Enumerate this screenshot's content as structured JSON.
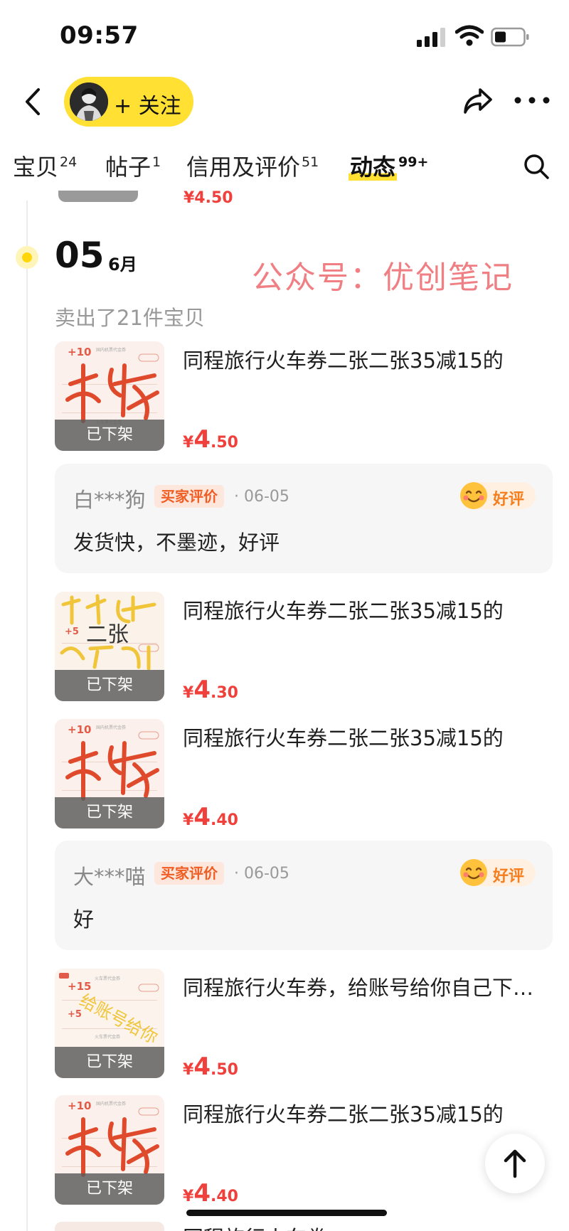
{
  "status_bar": {
    "time": "09:57"
  },
  "header": {
    "follow_label": "+ 关注"
  },
  "tabs": [
    {
      "label": "宝贝",
      "count": "24",
      "active": false
    },
    {
      "label": "帖子",
      "count": "1",
      "active": false
    },
    {
      "label": "信用及评价",
      "count": "51",
      "active": false
    },
    {
      "label": "动态",
      "count": "99+",
      "active": true
    }
  ],
  "feed": {
    "prev_price": "¥4.50",
    "date_day": "05",
    "date_month": "6月",
    "watermark": "公众号：优创笔记",
    "sold_summary": "卖出了21件宝贝",
    "products": [
      {
        "title": "同程旅行火车券二张二张35减15的",
        "currency": "¥",
        "price_int": "4",
        "price_dec": ".50",
        "status": "已下架"
      },
      {
        "title": "同程旅行火车券二张二张35减15的",
        "currency": "¥",
        "price_int": "4",
        "price_dec": ".30",
        "status": "已下架"
      },
      {
        "title": "同程旅行火车券二张二张35减15的",
        "currency": "¥",
        "price_int": "4",
        "price_dec": ".40",
        "status": "已下架"
      },
      {
        "title": "同程旅行火车券，给账号给你自己下…",
        "currency": "¥",
        "price_int": "4",
        "price_dec": ".50",
        "status": "已下架"
      },
      {
        "title": "同程旅行火车券二张二张35减15的",
        "currency": "¥",
        "price_int": "4",
        "price_dec": ".40",
        "status": "已下架"
      }
    ],
    "reviews": [
      {
        "user": "白***狗",
        "badge": "买家评价",
        "date": "· 06-05",
        "rating": "好评",
        "text": "发货快，不墨迹，好评"
      },
      {
        "user": "大***喵",
        "badge": "买家评价",
        "date": "· 06-05",
        "rating": "好评",
        "text": "好"
      }
    ],
    "next_title": "同程旅行火车券"
  },
  "colors": {
    "accent_yellow": "#ffe033",
    "price_red": "#f0403c",
    "badge_orange": "#f05d23",
    "watermark_pink": "#f07f84"
  },
  "icons": [
    "back-icon",
    "share-icon",
    "more-icon",
    "search-icon",
    "arrow-up-icon",
    "smile-emoji-icon"
  ]
}
